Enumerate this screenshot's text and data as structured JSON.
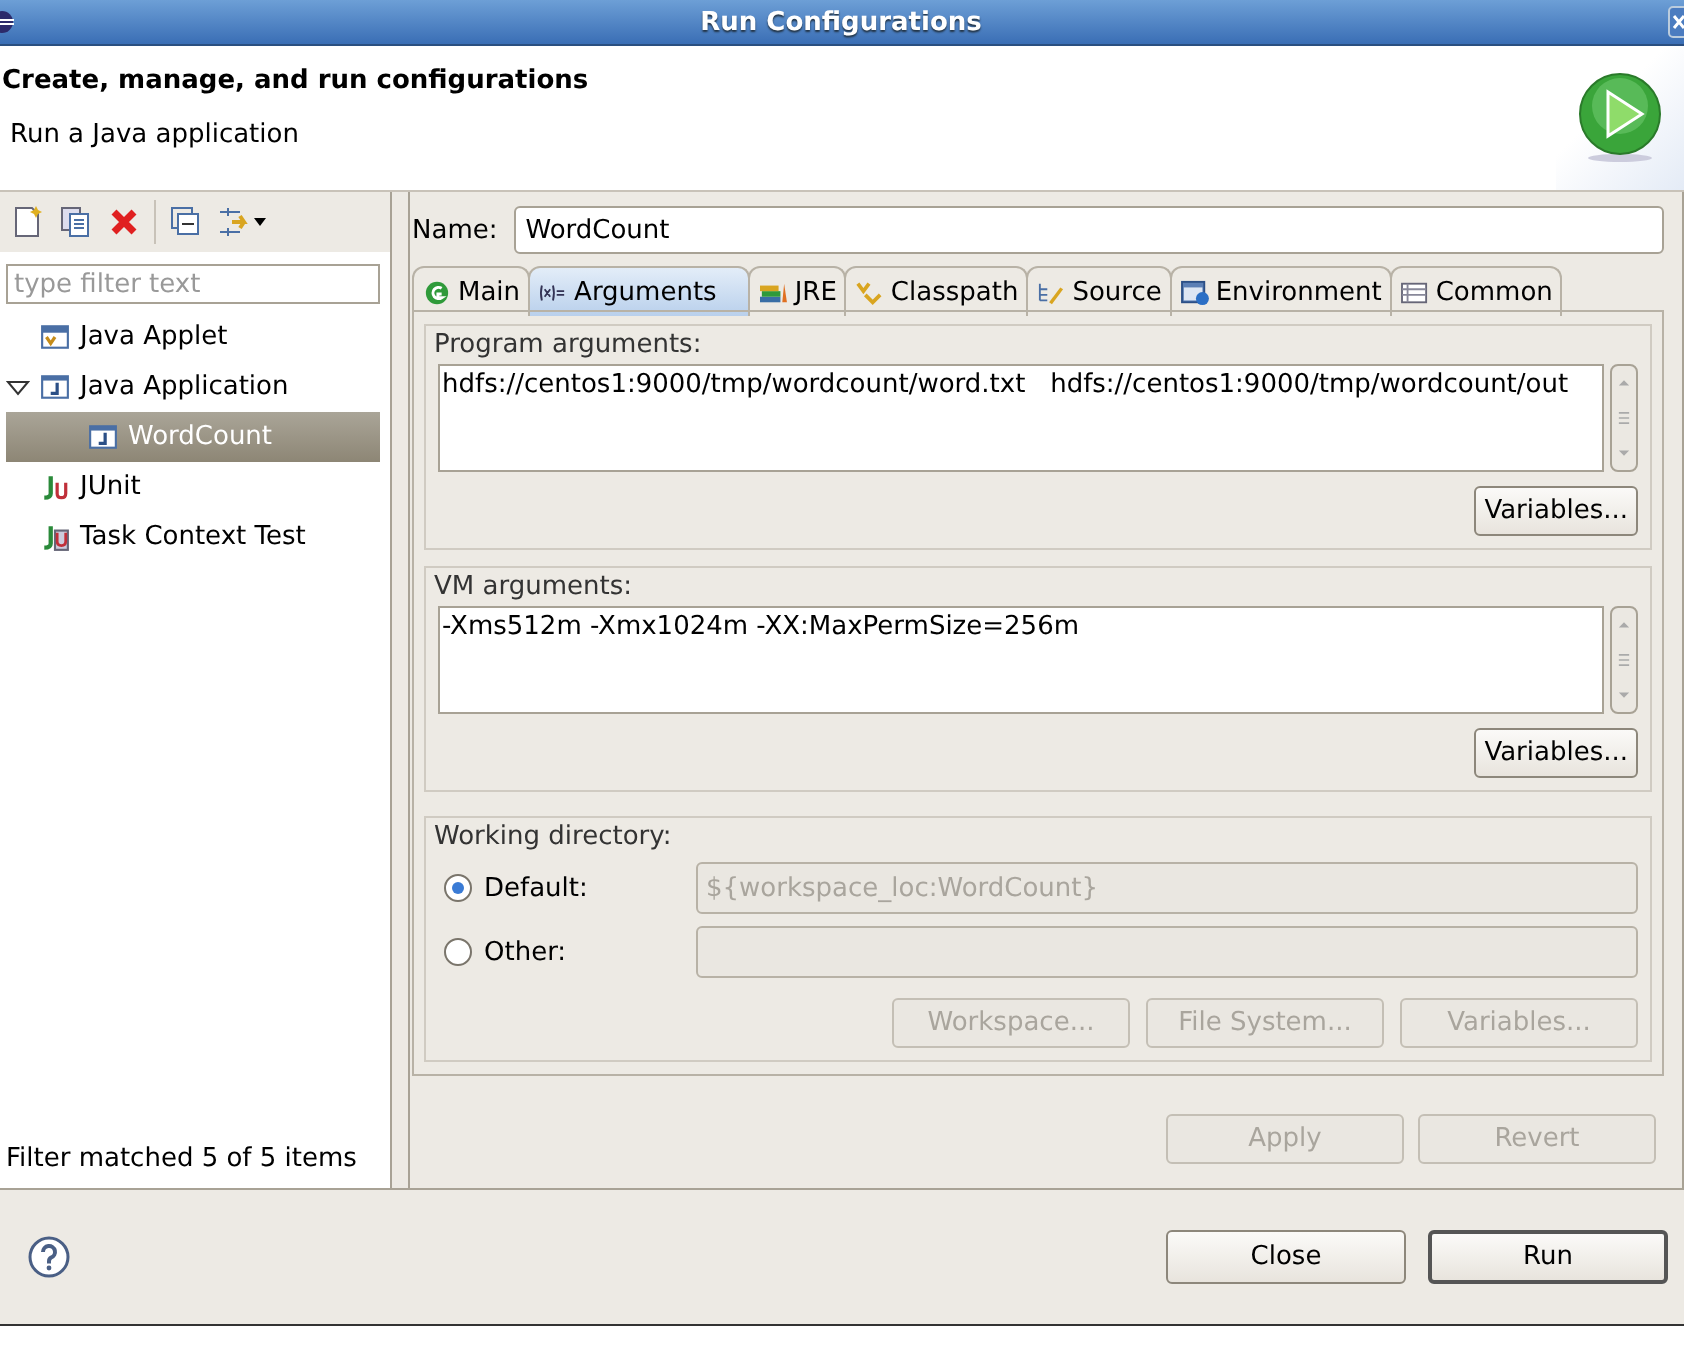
{
  "window": {
    "title": "Run Configurations"
  },
  "header": {
    "title": "Create, manage, and run configurations",
    "subtitle": "Run a Java application"
  },
  "sidebar": {
    "filter": {
      "placeholder": "type filter text"
    },
    "tree": [
      {
        "label": "Java Applet",
        "kind": "applet",
        "selected": false
      },
      {
        "label": "Java Application",
        "kind": "application",
        "selected": false,
        "expanded": true,
        "children": [
          {
            "label": "WordCount",
            "kind": "config",
            "selected": true
          }
        ]
      },
      {
        "label": "JUnit",
        "kind": "junit",
        "selected": false
      },
      {
        "label": "Task Context Test",
        "kind": "task",
        "selected": false
      }
    ],
    "status": "Filter matched 5 of 5 items"
  },
  "name_field": {
    "label": "Name:",
    "value": "WordCount"
  },
  "tabs": [
    {
      "label": "Main",
      "kind": "main",
      "selected": false
    },
    {
      "label": "Arguments",
      "kind": "arguments",
      "selected": true
    },
    {
      "label": "JRE",
      "kind": "jre",
      "selected": false
    },
    {
      "label": "Classpath",
      "kind": "classpath",
      "selected": false
    },
    {
      "label": "Source",
      "kind": "source",
      "selected": false
    },
    {
      "label": "Environment",
      "kind": "environment",
      "selected": false
    },
    {
      "label": "Common",
      "kind": "common",
      "selected": false
    }
  ],
  "program_arguments": {
    "label": "Program arguments:",
    "value": "hdfs://centos1:9000/tmp/wordcount/word.txt   hdfs://centos1:9000/tmp/wordcount/out",
    "button": "Variables..."
  },
  "vm_arguments": {
    "label": "VM arguments:",
    "value": "-Xms512m -Xmx1024m -XX:MaxPermSize=256m",
    "button": "Variables..."
  },
  "working_directory": {
    "label": "Working directory:",
    "options": [
      {
        "label": "Default:",
        "selected": true,
        "field": {
          "value": "${workspace_loc:WordCount}",
          "disabled": true
        }
      },
      {
        "label": "Other:",
        "selected": false,
        "field": {
          "disabled": true
        }
      }
    ],
    "buttons": [
      {
        "label": "Workspace...",
        "disabled": true
      },
      {
        "label": "File System...",
        "disabled": true
      },
      {
        "label": "Variables...",
        "disabled": true
      }
    ]
  },
  "actions": [
    {
      "label": "Apply",
      "disabled": true
    },
    {
      "label": "Revert",
      "disabled": true
    }
  ],
  "footer_buttons": [
    {
      "label": "Close",
      "default": false
    },
    {
      "label": "Run",
      "default": true
    }
  ]
}
